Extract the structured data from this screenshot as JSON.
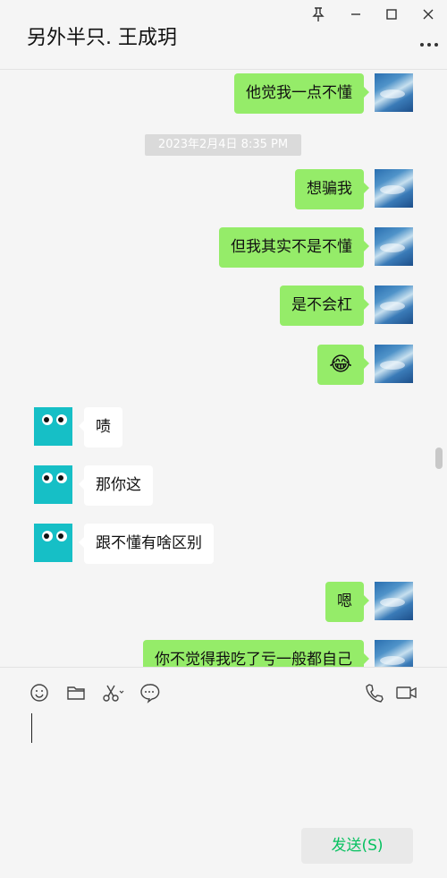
{
  "header": {
    "title": "另外半只. 王成玥",
    "icons": [
      "pin-icon",
      "minimize-icon",
      "maximize-icon",
      "close-icon",
      "more-icon"
    ]
  },
  "messages": [
    {
      "side": "self",
      "text": "他觉我一点不懂"
    },
    {
      "type": "timestamp",
      "text": "2023年2月4日 8:35 PM"
    },
    {
      "side": "self",
      "text": "想骗我"
    },
    {
      "side": "self",
      "text": "但我其实不是不懂"
    },
    {
      "side": "self",
      "text": "是不会杠"
    },
    {
      "side": "self",
      "text": "😂"
    },
    {
      "side": "peer",
      "text": "啧"
    },
    {
      "side": "peer",
      "text": "那你这"
    },
    {
      "side": "peer",
      "text": "跟不懂有啥区别"
    },
    {
      "side": "self",
      "text": "嗯"
    },
    {
      "side": "self",
      "text": "你不觉得我吃了亏一般都自己"
    }
  ],
  "toolbar": {
    "icons": [
      "emoji-icon",
      "folder-icon",
      "scissors-icon",
      "chat-history-icon",
      "phone-icon",
      "video-icon"
    ]
  },
  "input": {
    "value": ""
  },
  "send_button": {
    "label": "发送(S)"
  }
}
